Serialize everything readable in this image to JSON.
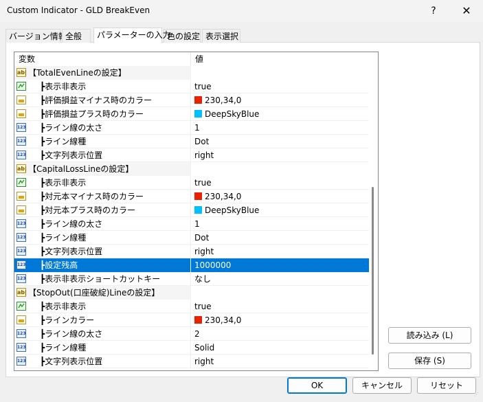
{
  "window": {
    "title": "Custom Indicator - GLD BreakEven",
    "help": "?",
    "close": "✕"
  },
  "tabs": [
    "パラメーターの入力",
    "バージョン情報",
    "全般",
    "色の設定",
    "表示選択"
  ],
  "grid": {
    "col_variable": "変数",
    "col_value": "値",
    "rows": [
      {
        "type": "group",
        "icon": "ab-icon",
        "label": "【TotalEvenLineの設定】",
        "value": ""
      },
      {
        "type": "item",
        "icon": "bool-icon",
        "label": "┣表示非表示",
        "value": "true"
      },
      {
        "type": "item",
        "icon": "color-icon",
        "label": "┣評価損益マイナス時のカラー",
        "value": "230,34,0",
        "swatch": "#e62200"
      },
      {
        "type": "item",
        "icon": "color-icon",
        "label": "┣評価損益プラス時のカラー",
        "value": "DeepSkyBlue",
        "swatch": "#00bfff"
      },
      {
        "type": "item",
        "icon": "num-icon",
        "label": "┣ライン線の太さ",
        "value": "1"
      },
      {
        "type": "item",
        "icon": "num-icon",
        "label": "┣ライン線種",
        "value": "Dot"
      },
      {
        "type": "item",
        "icon": "num-icon",
        "label": "┣文字列表示位置",
        "value": "right"
      },
      {
        "type": "group",
        "icon": "ab-icon",
        "label": "【CapitalLossLineの設定】",
        "value": ""
      },
      {
        "type": "item",
        "icon": "bool-icon",
        "label": "┣表示非表示",
        "value": "true"
      },
      {
        "type": "item",
        "icon": "color-icon",
        "label": "┣対元本マイナス時のカラー",
        "value": "230,34,0",
        "swatch": "#e62200"
      },
      {
        "type": "item",
        "icon": "color-icon",
        "label": "┣対元本プラス時のカラー",
        "value": "DeepSkyBlue",
        "swatch": "#00bfff"
      },
      {
        "type": "item",
        "icon": "num-icon",
        "label": "┣ライン線の太さ",
        "value": "1"
      },
      {
        "type": "item",
        "icon": "num-icon",
        "label": "┣ライン線種",
        "value": "Dot"
      },
      {
        "type": "item",
        "icon": "num-icon",
        "label": "┣文字列表示位置",
        "value": "right"
      },
      {
        "type": "item",
        "icon": "num-icon",
        "label": "┣設定残高",
        "value": "1000000",
        "selected": true
      },
      {
        "type": "item",
        "icon": "num-icon",
        "label": "┣表示非表示ショートカットキー",
        "value": "なし"
      },
      {
        "type": "group",
        "icon": "ab-icon",
        "label": "【StopOut(口座破綻)Lineの設定】",
        "value": ""
      },
      {
        "type": "item",
        "icon": "bool-icon",
        "label": "┣表示非表示",
        "value": "true"
      },
      {
        "type": "item",
        "icon": "color-icon",
        "label": "┣ラインカラー",
        "value": "230,34,0",
        "swatch": "#e62200"
      },
      {
        "type": "item",
        "icon": "num-icon",
        "label": "┣ライン線の太さ",
        "value": "2"
      },
      {
        "type": "item",
        "icon": "num-icon",
        "label": "┣ライン線種",
        "value": "Solid"
      },
      {
        "type": "item",
        "icon": "num-icon",
        "label": "┣文字列表示位置",
        "value": "right"
      }
    ]
  },
  "side_buttons": {
    "load": "読み込み (L)",
    "save": "保存 (S)"
  },
  "footer_buttons": {
    "ok": "OK",
    "cancel": "キャンセル",
    "reset": "リセット"
  },
  "icon_text": {
    "ab": "ab|",
    "num": "123"
  }
}
